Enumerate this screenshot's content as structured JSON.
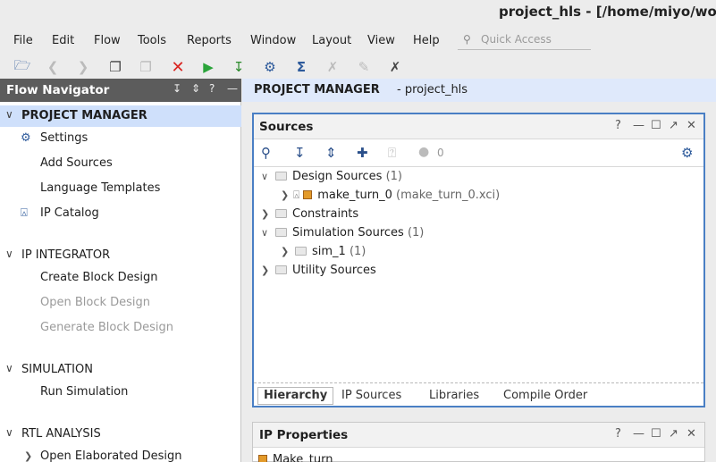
{
  "window": {
    "title": "project_hls - [/home/miyo/wor"
  },
  "menu": [
    "File",
    "Edit",
    "Flow",
    "Tools",
    "Reports",
    "Window",
    "Layout",
    "View",
    "Help"
  ],
  "quick_access": {
    "placeholder": "Quick Access"
  },
  "toolbar": {
    "icons": [
      "open-folder-icon",
      "undo-icon",
      "redo-icon",
      "copy-icon",
      "paste-icon",
      "delete-icon",
      "run-icon",
      "program-device-icon",
      "settings-icon",
      "sigma-icon",
      "disabled-tool-icon",
      "disabled-edit-icon",
      "cross-tool-icon"
    ]
  },
  "flow_navigator": {
    "title": "Flow Navigator",
    "sections": [
      {
        "title": "PROJECT MANAGER",
        "items": [
          "Settings",
          "Add Sources",
          "Language Templates",
          "IP Catalog"
        ]
      },
      {
        "title": "IP INTEGRATOR",
        "items": [
          "Create Block Design",
          "Open Block Design",
          "Generate Block Design"
        ]
      },
      {
        "title": "SIMULATION",
        "items": [
          "Run Simulation"
        ]
      },
      {
        "title": "RTL ANALYSIS",
        "items": [
          "Open Elaborated Design"
        ]
      }
    ]
  },
  "project_manager": {
    "label": "PROJECT MANAGER",
    "project": " - project_hls"
  },
  "sources": {
    "title": "Sources",
    "badge_count": "0",
    "tree": [
      {
        "label": "Design Sources",
        "count": "(1)"
      },
      {
        "label": "make_turn_0",
        "detail": "(make_turn_0.xci)"
      },
      {
        "label": "Constraints"
      },
      {
        "label": "Simulation Sources",
        "count": "(1)"
      },
      {
        "label": "sim_1",
        "count": "(1)"
      },
      {
        "label": "Utility Sources"
      }
    ],
    "tabs": [
      "Hierarchy",
      "IP Sources",
      "Libraries",
      "Compile Order"
    ],
    "active_tab": "Hierarchy"
  },
  "ip_properties": {
    "title": "IP Properties",
    "item": "Make_turn"
  },
  "colors": {
    "accent": "#4a7fc4",
    "nav_header": "#5c5c5c",
    "selected": "#cfe0fb",
    "error": "#d9231f",
    "run": "#2aa43a"
  }
}
